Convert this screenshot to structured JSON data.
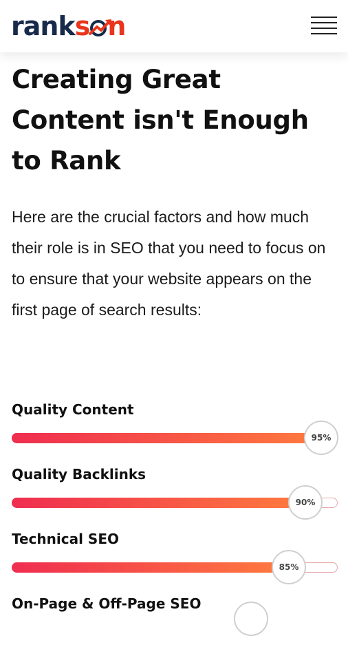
{
  "header": {
    "logo_text": "rankson",
    "menu_icon": "hamburger-menu-icon"
  },
  "main": {
    "title": "Creating Great Content isn't Enough to Rank",
    "intro": "Here are the crucial factors and how much their role is in SEO that you need to focus on to ensure that your website appears on the first page of search results:"
  },
  "factors": [
    {
      "label": "Quality Content",
      "percent_label": "95%",
      "value": 95
    },
    {
      "label": "Quality Backlinks",
      "percent_label": "90%",
      "value": 90
    },
    {
      "label": "Technical SEO",
      "percent_label": "85%",
      "value": 85
    },
    {
      "label": "On-Page & Off-Page SEO",
      "percent_label": "",
      "value": null
    }
  ],
  "colors": {
    "brand_navy": "#182a4b",
    "brand_red": "#e8351c",
    "bar_gradient_start": "#ef2d50",
    "bar_gradient_end": "#ff7b3e"
  }
}
